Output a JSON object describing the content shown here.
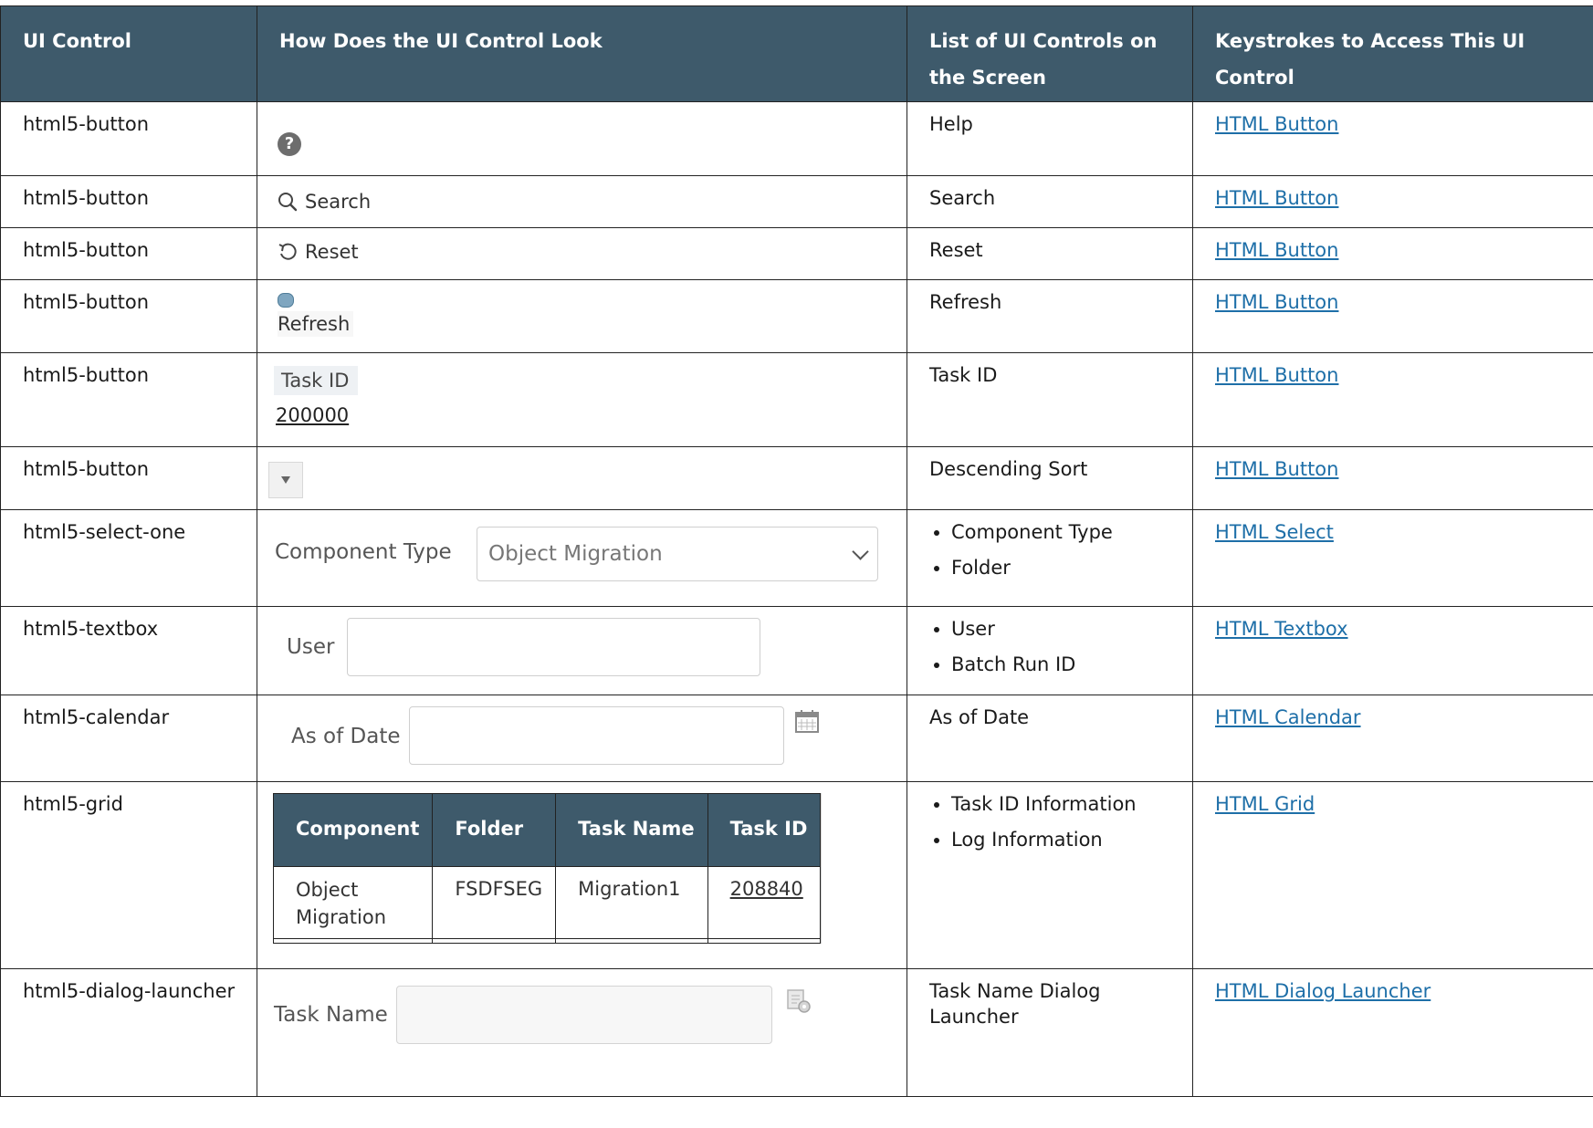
{
  "headers": {
    "ui_control": "UI Control",
    "look": "How Does the UI Control Look",
    "list": "List of UI Controls on the Screen",
    "keystrokes": "Keystrokes to Access This UI Control"
  },
  "rows": [
    {
      "control": "html5-button",
      "list": "Help",
      "link": "HTML Button"
    },
    {
      "control": "html5-button",
      "list": "Search",
      "link": "HTML Button",
      "mock_label": "Search"
    },
    {
      "control": "html5-button",
      "list": "Reset",
      "link": "HTML Button",
      "mock_label": "Reset"
    },
    {
      "control": "html5-button",
      "list": "Refresh",
      "link": "HTML Button",
      "mock_label": "Refresh"
    },
    {
      "control": "html5-button",
      "list": "Task ID",
      "link": "HTML Button",
      "mock_header": "Task ID",
      "mock_value": "200000"
    },
    {
      "control": "html5-button",
      "list": "Descending Sort",
      "link": "HTML Button"
    },
    {
      "control": "html5-select-one",
      "list_items": [
        "Component Type",
        "Folder"
      ],
      "link": "HTML Select",
      "mock_label": "Component Type",
      "mock_value": "Object Migration"
    },
    {
      "control": "html5-textbox",
      "list_items": [
        "User",
        "Batch Run ID"
      ],
      "link": "HTML Textbox",
      "mock_label": "User"
    },
    {
      "control": "html5-calendar",
      "list": "As of Date",
      "link": "HTML Calendar",
      "mock_label": "As of Date"
    },
    {
      "control": "html5-grid",
      "list_items": [
        "Task ID Information",
        "Log Information"
      ],
      "link": "HTML Grid",
      "grid": {
        "columns": [
          "Component",
          "Folder",
          "Task Name",
          "Task ID"
        ],
        "row": [
          "Object Migration",
          "FSDFSEG",
          "Migration1",
          "208840"
        ]
      }
    },
    {
      "control": "html5-dialog-launcher",
      "list": "Task Name Dialog Launcher",
      "link": "HTML Dialog Launcher",
      "mock_label": "Task Name"
    }
  ],
  "icons": [
    "help-icon",
    "search-icon",
    "reset-icon",
    "refresh-icon",
    "sort-descending-icon",
    "chevron-down-icon",
    "calendar-icon",
    "dialog-launcher-icon"
  ],
  "colors": {
    "header_bg": "#3e5a6b",
    "link": "#1e6fa8"
  }
}
